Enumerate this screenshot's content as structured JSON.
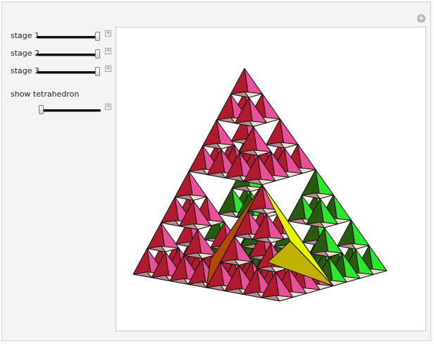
{
  "controls": {
    "sliders": [
      {
        "label": "stage 1",
        "value": 1.0
      },
      {
        "label": "stage 2",
        "value": 1.0
      },
      {
        "label": "stage 3",
        "value": 1.0
      }
    ],
    "tetrahedron": {
      "label": "show tetrahedron",
      "value": 0.0
    },
    "plus_glyph": "+"
  },
  "icons": {
    "corner": "plus-circle-icon",
    "expand": "plus-box-icon"
  },
  "colors": {
    "frame_bg": "#f4f4f4",
    "yellow": "#e6f500",
    "orange": "#b34a00",
    "magenta": "#e8509a",
    "crimson": "#b01a2e",
    "green": "#2fe62f",
    "olive": "#c0b000",
    "dark_green": "#2a5a10",
    "mauve": "#b98a92",
    "cream": "#ece0cc"
  }
}
